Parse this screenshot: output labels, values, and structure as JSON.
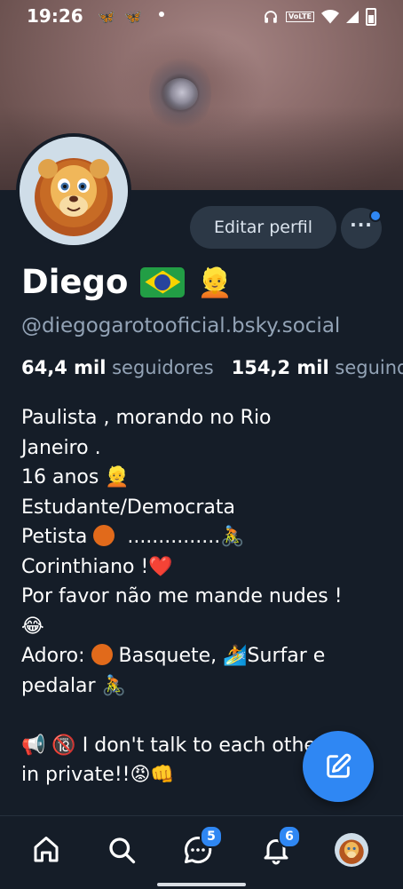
{
  "status_bar": {
    "time": "19:26",
    "butterfly_1": "🦋",
    "butterfly_2": "🦋",
    "volte_label": "VoLTE",
    "icons": [
      "headphones-icon",
      "volte-icon",
      "wifi-icon",
      "signal-icon",
      "battery-icon"
    ]
  },
  "profile": {
    "edit_button": "Editar perfil",
    "more_button": "···",
    "name": "Diego",
    "name_emoji": "👱",
    "handle": "@diegogarotooficial.bsky.social",
    "followers_count": "64,4 mil",
    "followers_label": "seguidores",
    "following_count": "154,2 mil",
    "following_label": "seguindo"
  },
  "bio": {
    "line1": "Paulista , morando no Rio",
    "line2": "Janeiro .",
    "line3": "16 anos 👱",
    "line4": "Estudante/Democrata",
    "line5_text": "Petista",
    "line5_dots": "...............🚴",
    "line6": "Corinthiano !❤️",
    "line7": "Por favor não me mande nudes !",
    "line8": "😂",
    "line9_a": "Adoro:",
    "line9_b": "Basquete, 🏄Surfar e",
    "line10": "pedalar 🚴",
    "line11": "📢  🔞 I don't  talk to each other",
    "line12": "in private!!😡👊"
  },
  "nav": {
    "chat_badge": "5",
    "notifications_badge": "6"
  },
  "colors": {
    "background": "#151d28",
    "accent": "#2f87f3",
    "muted_text": "#93a3b6",
    "button_bg": "#2c3846"
  }
}
